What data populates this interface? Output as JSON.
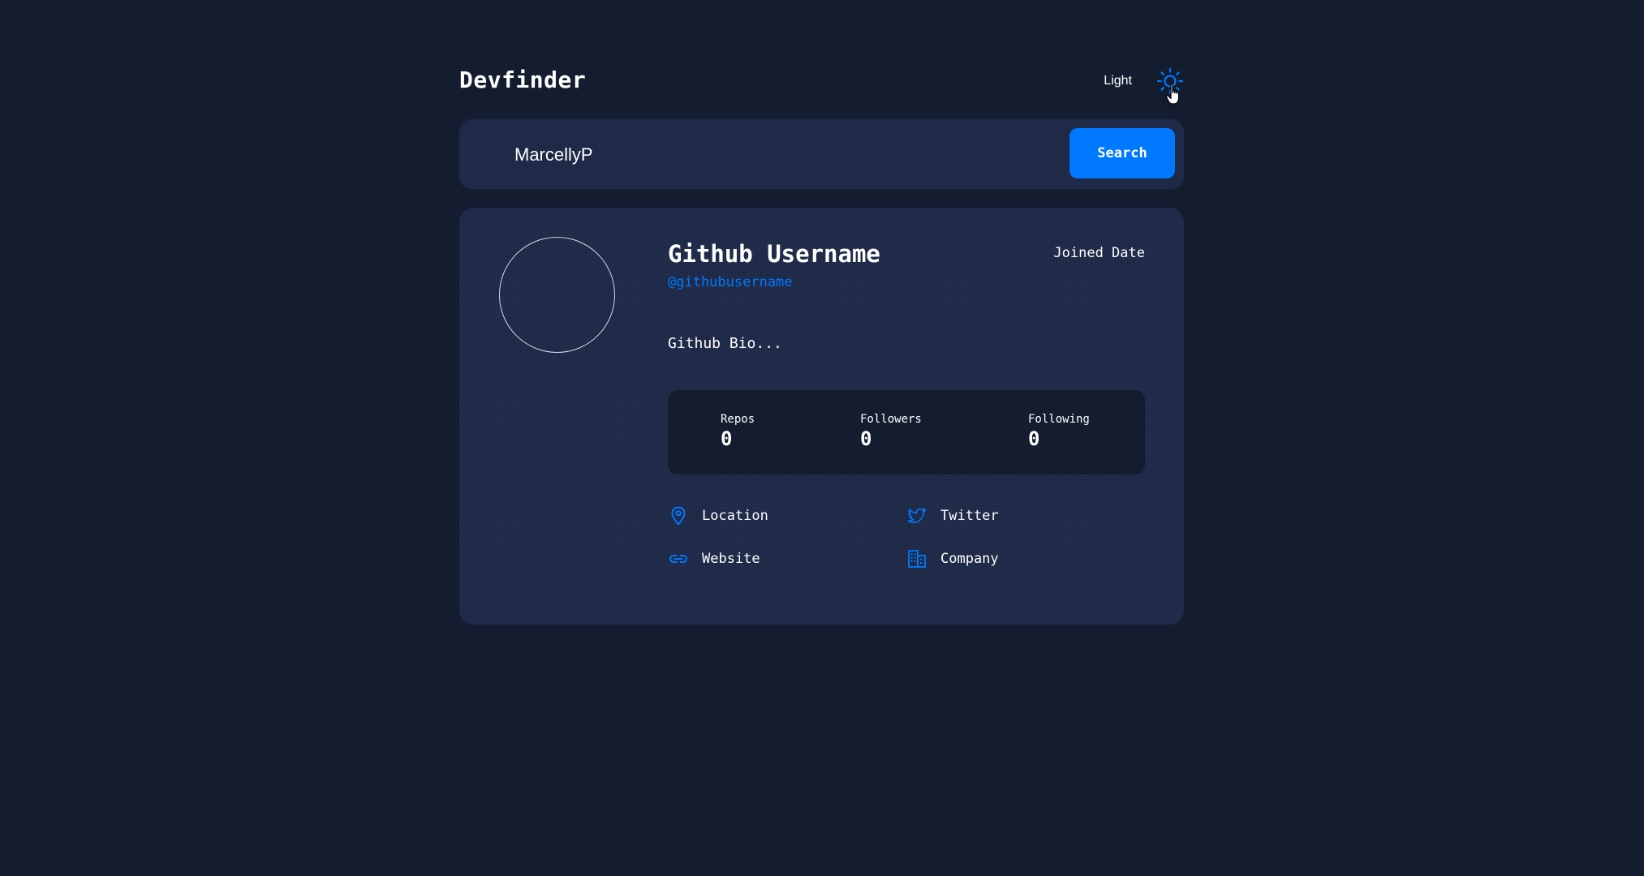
{
  "app": {
    "title": "Devfinder"
  },
  "theme": {
    "label": "Light",
    "icon": "sun-icon",
    "accent": "#0079ff"
  },
  "search": {
    "value": "MarcellyP",
    "button_label": "Search"
  },
  "profile": {
    "name": "Github Username",
    "joined": "Joined Date",
    "handle": "@githubusername",
    "bio": "Github Bio...",
    "stats": [
      {
        "label": "Repos",
        "value": "0"
      },
      {
        "label": "Followers",
        "value": "0"
      },
      {
        "label": "Following",
        "value": "0"
      }
    ],
    "links": {
      "location": "Location",
      "twitter": "Twitter",
      "website": "Website",
      "company": "Company"
    }
  },
  "colors": {
    "background": "#141d2f",
    "card": "#1e2a47",
    "accent": "#0079ff",
    "text": "#ffffff"
  }
}
